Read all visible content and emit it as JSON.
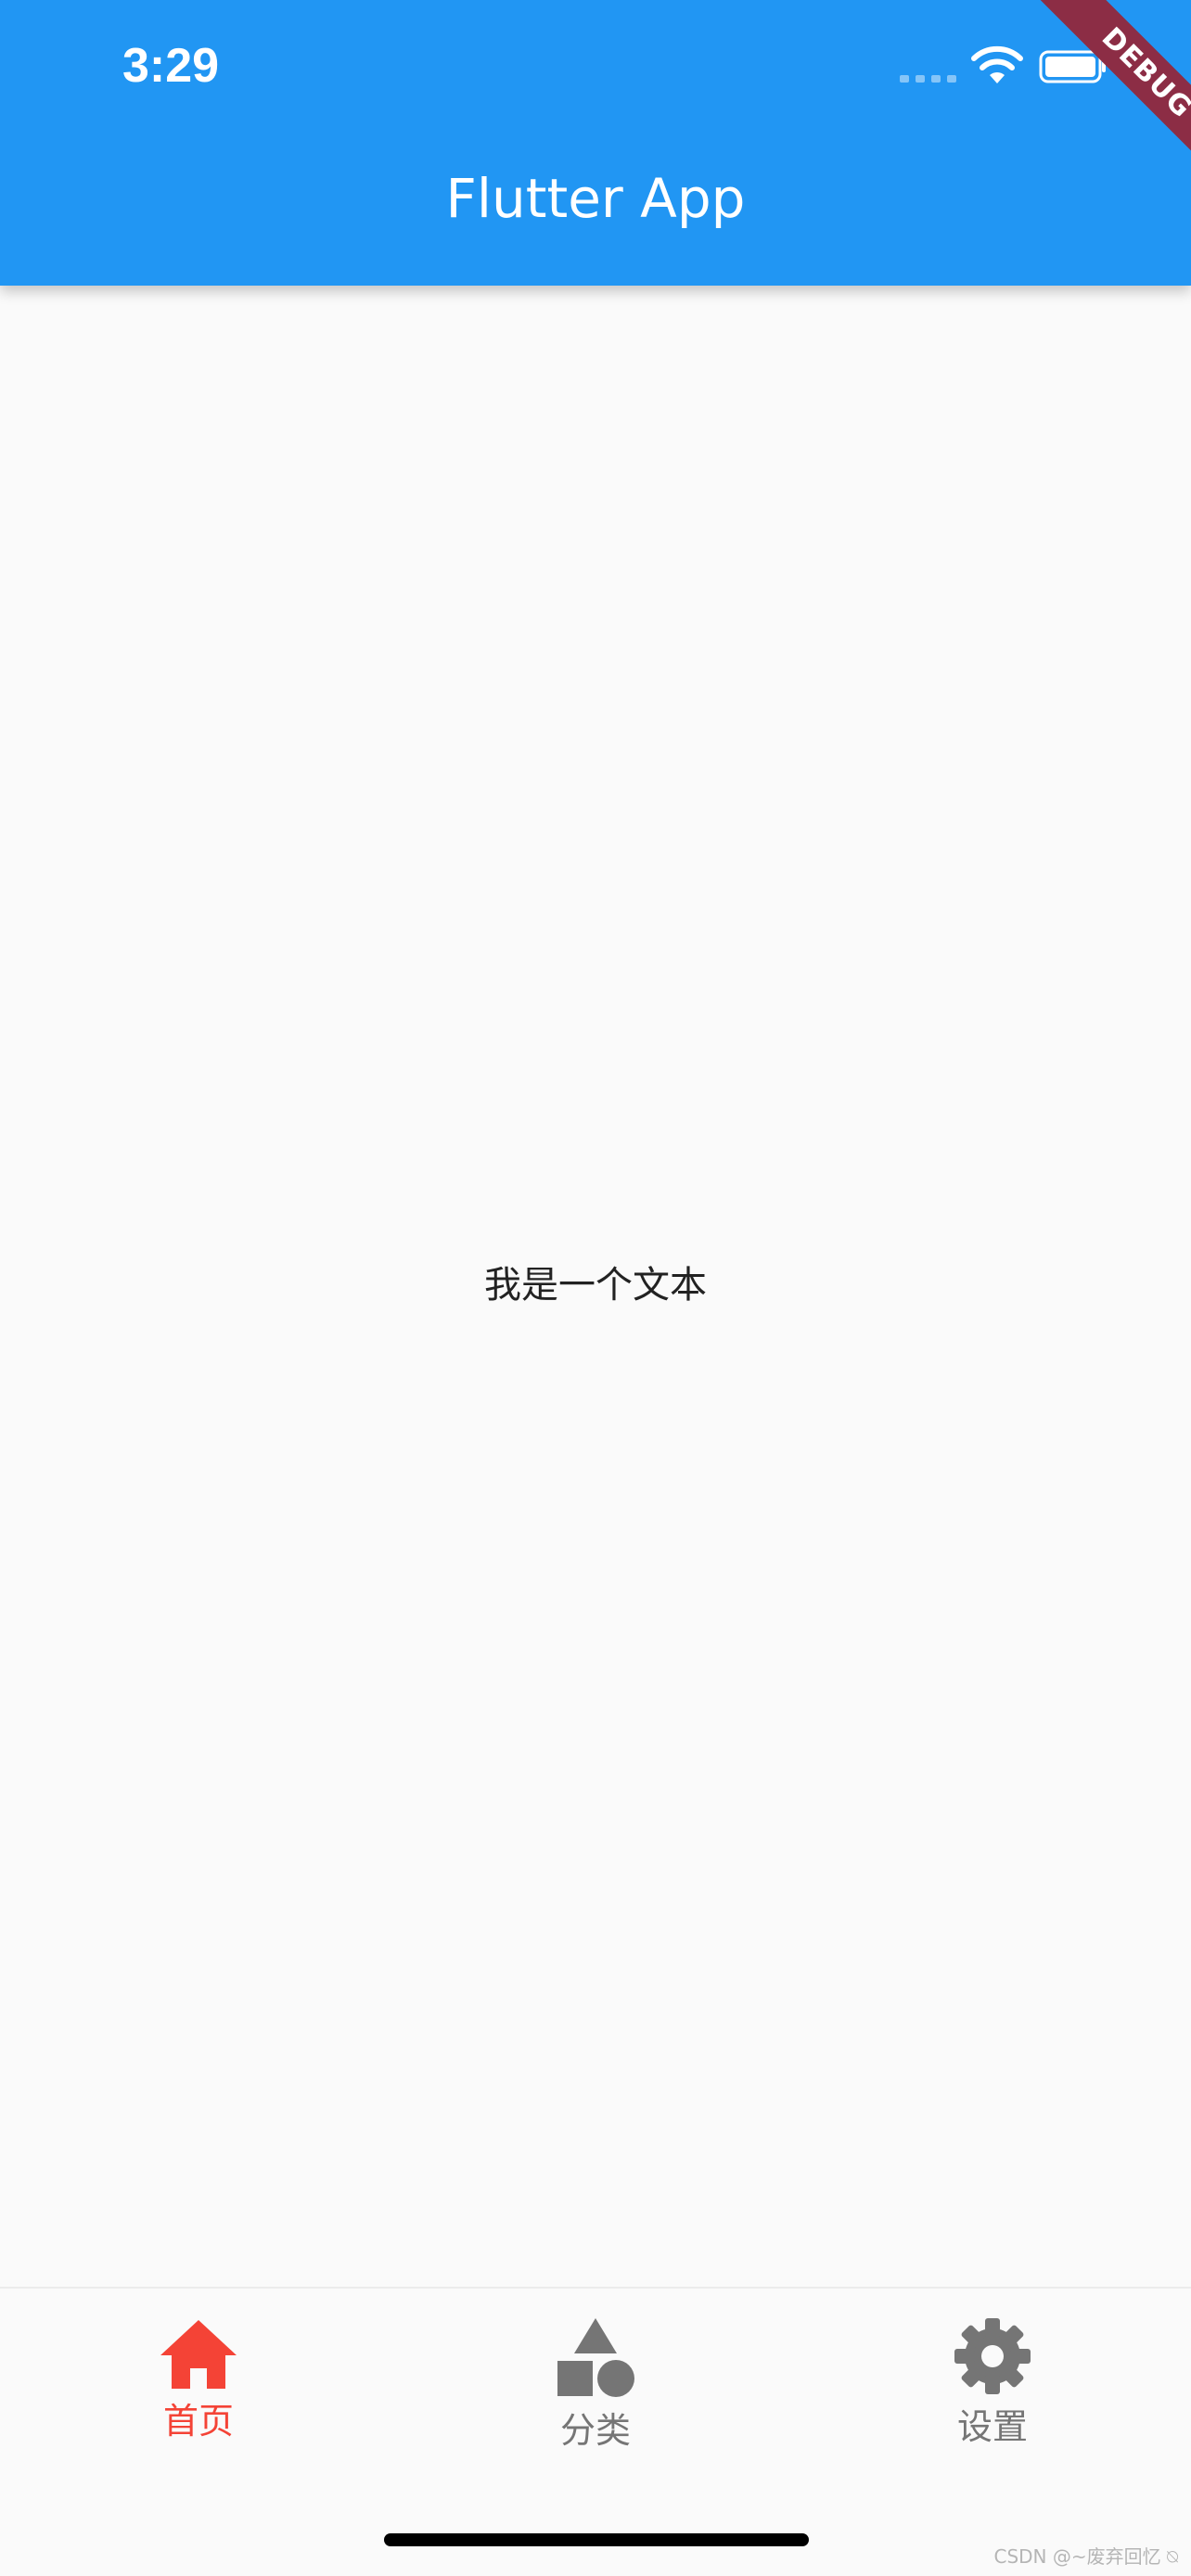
{
  "status_bar": {
    "time": "3:29"
  },
  "app_bar": {
    "title": "Flutter App",
    "color": "#2196f3"
  },
  "debug_banner": {
    "label": "DEBUG",
    "color": "#8c2d45"
  },
  "body": {
    "text": "我是一个文本"
  },
  "bottom_nav": {
    "active_color": "#f44336",
    "inactive_color": "#757575",
    "items": [
      {
        "label": "首页",
        "icon": "home-icon",
        "active": true
      },
      {
        "label": "分类",
        "icon": "category-icon",
        "active": false
      },
      {
        "label": "设置",
        "icon": "settings-icon",
        "active": false
      }
    ]
  },
  "watermark": {
    "text": "CSDN @~废弃回忆 ⍉"
  }
}
